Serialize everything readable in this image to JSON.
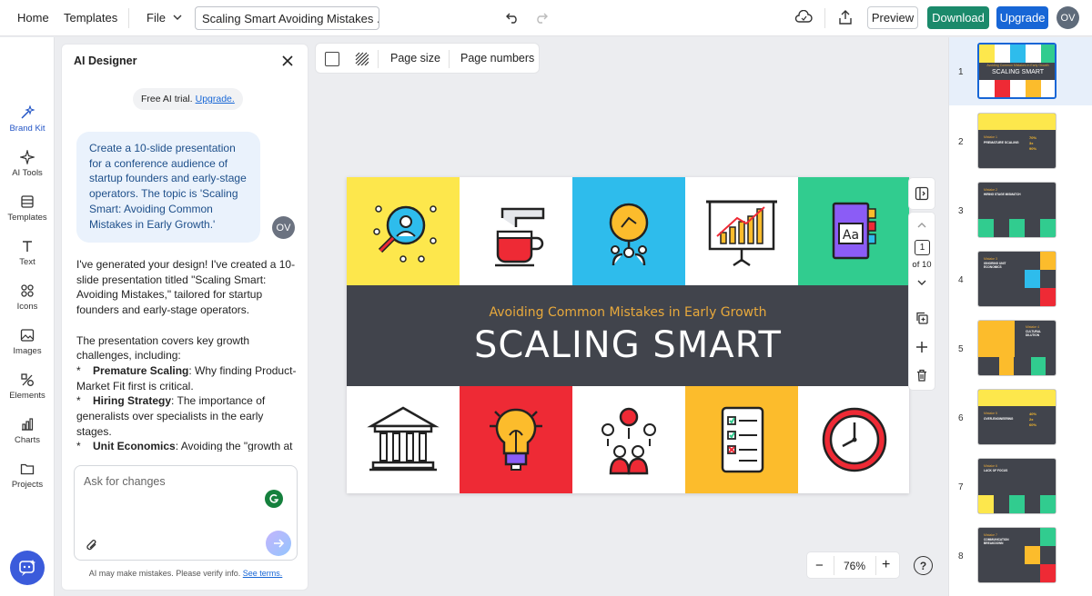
{
  "topbar": {
    "home": "Home",
    "templates": "Templates",
    "file": "File",
    "doc_title": "Scaling Smart Avoiding Mistakes ...",
    "preview": "Preview",
    "download": "Download",
    "upgrade": "Upgrade",
    "avatar": "OV"
  },
  "leftnav": {
    "items": [
      {
        "label": "Brand Kit",
        "icon": "brand-kit-icon"
      },
      {
        "label": "AI Tools",
        "icon": "ai-tools-icon"
      },
      {
        "label": "Templates",
        "icon": "templates-icon"
      },
      {
        "label": "Text",
        "icon": "text-icon"
      },
      {
        "label": "Icons",
        "icon": "icons-icon"
      },
      {
        "label": "Images",
        "icon": "images-icon"
      },
      {
        "label": "Elements",
        "icon": "elements-icon"
      },
      {
        "label": "Charts",
        "icon": "charts-icon"
      },
      {
        "label": "Projects",
        "icon": "projects-icon"
      }
    ]
  },
  "ai_panel": {
    "title": "AI Designer",
    "trial_text": "Free AI trial.",
    "trial_link": "Upgrade.",
    "user_message": "Create a 10-slide presentation for a conference audience of startup founders and early-stage operators. The topic is 'Scaling Smart: Avoiding Common Mistakes in Early Growth.'",
    "user_avatar": "OV",
    "reply_intro": "I've generated your design! I've created a 10-slide presentation titled \"Scaling Smart: Avoiding Mistakes,\" tailored for startup founders and early-stage operators.",
    "reply_challenges": "The presentation covers key growth challenges, including:",
    "bullets": [
      {
        "marker": "*",
        "title": "Premature Scaling",
        "text": ": Why finding Product-Market Fit first is critical."
      },
      {
        "marker": "*",
        "title": "Hiring Strategy",
        "text": ": The importance of generalists over specialists in the early stages."
      },
      {
        "marker": "*",
        "title": "Unit Economics",
        "text": ": Avoiding the \"growth at all costs\" trap"
      }
    ],
    "input_placeholder": "Ask for changes",
    "disclaimer": "AI may make mistakes. Please verify info.",
    "disclaimer_link": "See terms."
  },
  "page_toolbar": {
    "page_size": "Page size",
    "page_numbers": "Page numbers"
  },
  "slide": {
    "subtitle": "Avoiding Common Mistakes in Early Growth",
    "title": "SCALING SMART",
    "top_tiles": [
      "#fde74c",
      "#ffffff",
      "#2ebcec",
      "#ffffff",
      "#31cc8f"
    ],
    "bottom_tiles": [
      "#ffffff",
      "#ee2a35",
      "#ffffff",
      "#fcbc2c",
      "#ffffff"
    ]
  },
  "page_nav": {
    "current": "1",
    "total": "of 10"
  },
  "zoom": {
    "minus": "−",
    "value": "76%",
    "plus": "+",
    "help": "?"
  },
  "thumbnails": {
    "numbers": [
      "1",
      "2",
      "3",
      "4",
      "5",
      "6",
      "7",
      "8"
    ],
    "slide1_sub": "Avoiding Common Mistakes in Early Growth",
    "slide1_title": "SCALING SMART",
    "slide2_label": "Mistake 1",
    "slide2_title": "PREMATURE SCALING",
    "slide2_stats": [
      "70%",
      "3x",
      "90%"
    ],
    "slide3_label": "Mistake 2",
    "slide3_title": "HIRING STAGE MISMATCH",
    "slide4_label": "Mistake 3",
    "slide4_title": "IGNORING UNIT ECONOMICS",
    "slide5_label": "Mistake 4",
    "slide5_title": "CULTURAL DILUTION",
    "slide6_label": "Mistake 5",
    "slide6_title": "OVER-ENGINEERING",
    "slide6_stats": [
      "40%",
      "2x",
      "60%"
    ],
    "slide7_label": "Mistake 6",
    "slide7_title": "LACK OF FOCUS",
    "slide8_label": "Mistake 7",
    "slide8_title": "COMMUNICATION BREAKDOWN"
  },
  "colors": {
    "download": "#1b8a6b",
    "upgrade": "#1766d6",
    "banner": "#41444c",
    "subtitle": "#e8a93c"
  }
}
